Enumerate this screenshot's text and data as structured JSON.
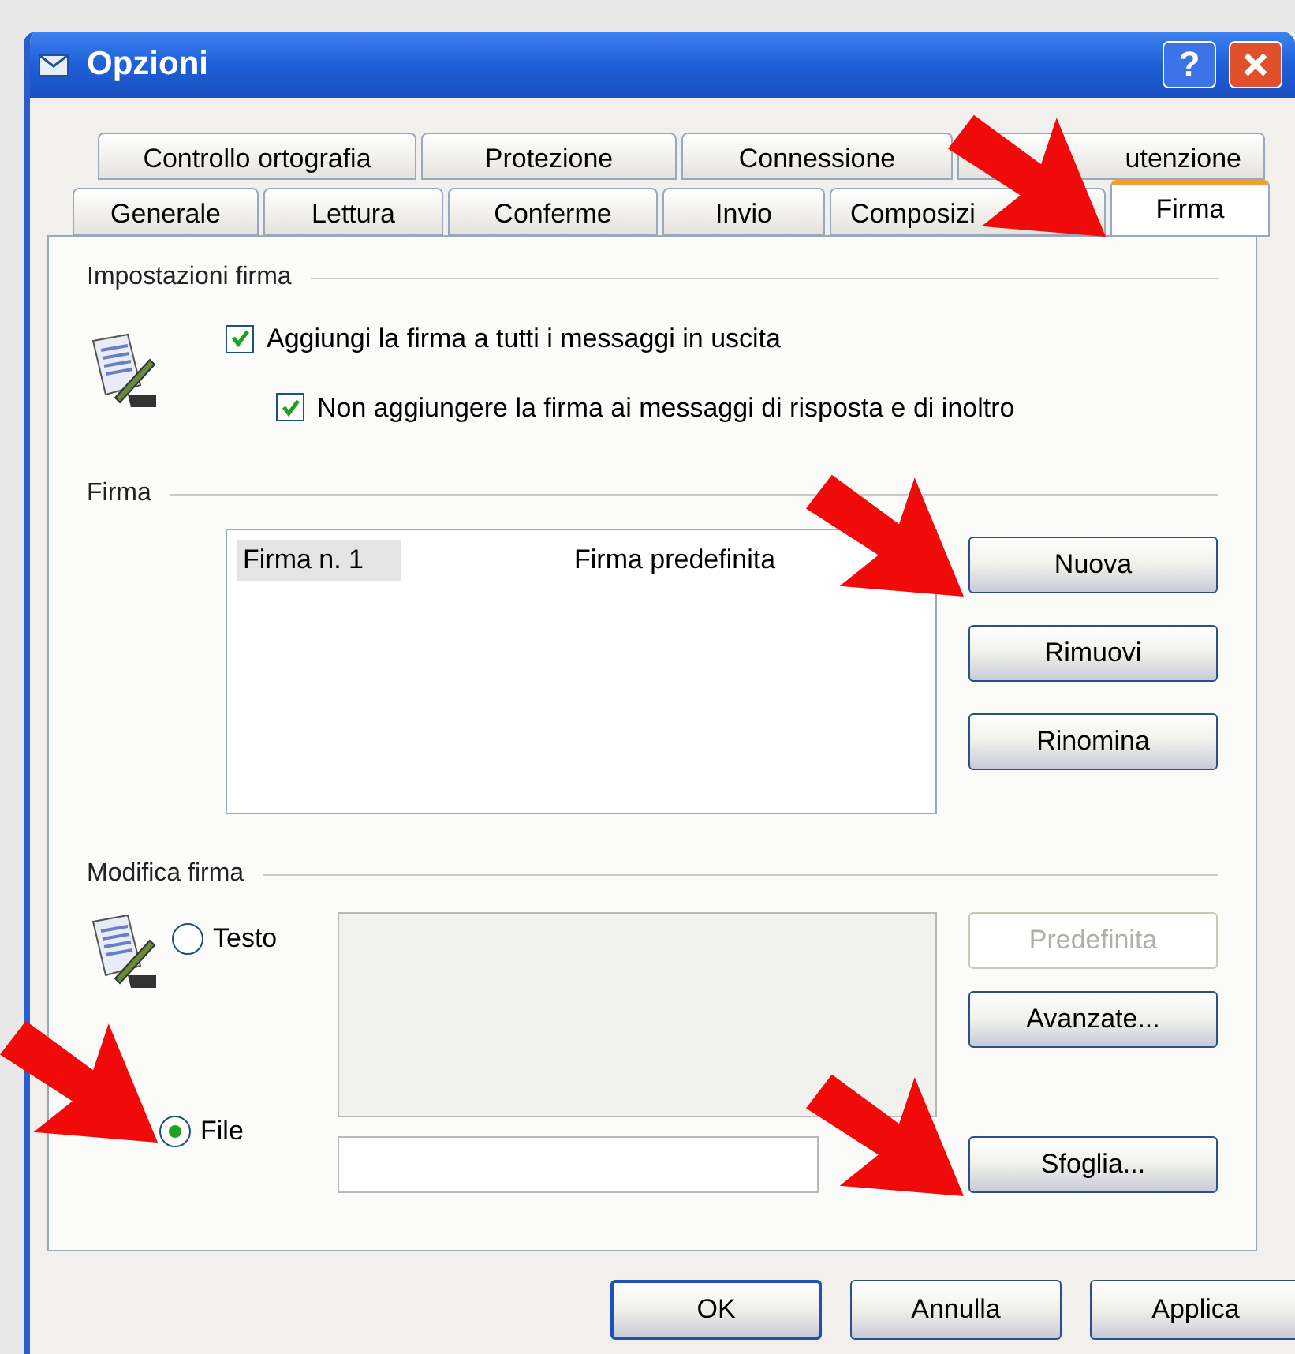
{
  "window": {
    "title": "Opzioni",
    "help": "?"
  },
  "tabs": {
    "back_row": [
      {
        "label": "Controllo ortografia",
        "selected": false
      },
      {
        "label": "Protezione",
        "selected": false
      },
      {
        "label": "Connessione",
        "selected": false
      },
      {
        "label": "utenzione",
        "selected": false
      }
    ],
    "front_row": [
      {
        "label": "Generale",
        "selected": false
      },
      {
        "label": "Lettura",
        "selected": false
      },
      {
        "label": "Conferme",
        "selected": false
      },
      {
        "label": "Invio",
        "selected": false
      },
      {
        "label": "Composizi",
        "selected": false
      },
      {
        "label": "Firma",
        "selected": true
      }
    ]
  },
  "signature_settings": {
    "title": "Impostazioni firma",
    "checkboxes": [
      {
        "label": "Aggiungi la firma a tutti i messaggi in uscita",
        "checked": true
      },
      {
        "label": "Non aggiungere la firma ai messaggi di risposta e di inoltro",
        "checked": true
      }
    ]
  },
  "signatures": {
    "title": "Firma",
    "rows": [
      {
        "name": "Firma n. 1",
        "description": "Firma predefinita",
        "selected": true
      }
    ],
    "buttons": [
      {
        "label": "Nuova",
        "disabled": false
      },
      {
        "label": "Rimuovi",
        "disabled": false
      },
      {
        "label": "Rinomina",
        "disabled": false
      }
    ]
  },
  "edit_signature": {
    "title": "Modifica firma",
    "options": [
      {
        "label": "Testo",
        "selected": false
      },
      {
        "label": "File",
        "selected": true
      }
    ],
    "buttons": [
      {
        "label": "Predefinita",
        "disabled": true
      },
      {
        "label": "Avanzate...",
        "disabled": false
      },
      {
        "label": "Sfoglia...",
        "disabled": false
      }
    ]
  },
  "footer_buttons": [
    "OK",
    "Annulla",
    "Applica"
  ]
}
